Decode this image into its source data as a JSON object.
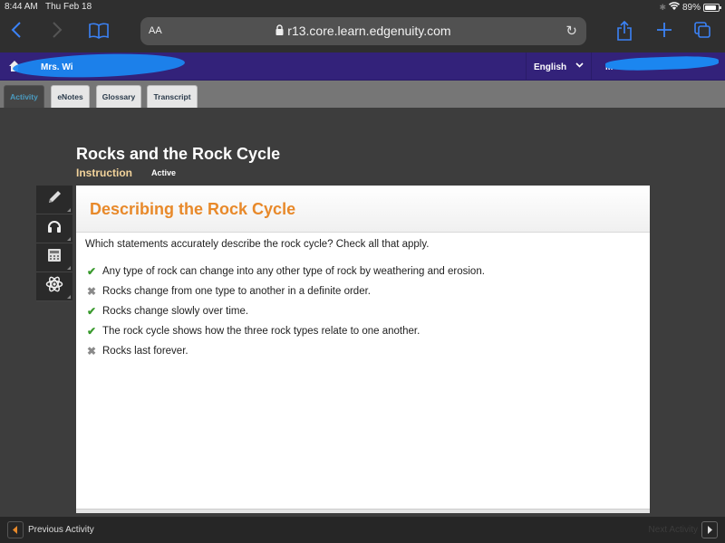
{
  "status_bar": {
    "time": "8:44 AM",
    "date": "Thu Feb 18",
    "battery_percent": "89%",
    "battery_level": 0.89
  },
  "browser": {
    "text_size_label": "AA",
    "url": "r13.core.learn.edgenuity.com",
    "icons": [
      "back-icon",
      "forward-icon",
      "bookmarks-icon",
      "lock-icon",
      "reload-icon",
      "share-icon",
      "new-tab-icon",
      "tabs-icon"
    ]
  },
  "app_header": {
    "course_title": "Mrs. Wi",
    "language": "English",
    "user_name": "M",
    "bg_color": "#33227a"
  },
  "tabs": [
    {
      "label": "Activity",
      "active": true
    },
    {
      "label": "eNotes",
      "active": false
    },
    {
      "label": "Glossary",
      "active": false
    },
    {
      "label": "Transcript",
      "active": false
    }
  ],
  "lesson": {
    "title": "Rocks and the Rock Cycle",
    "section": "Instruction",
    "status": "Active"
  },
  "tools": [
    {
      "name": "pencil-icon"
    },
    {
      "name": "headphones-icon"
    },
    {
      "name": "calculator-icon"
    },
    {
      "name": "atom-icon"
    }
  ],
  "card": {
    "title": "Describing the Rock Cycle",
    "title_color": "#e8892a",
    "question": "Which statements accurately describe the rock cycle? Check all that apply.",
    "answers": [
      {
        "text": "Any type of rock can change into any other type of rock by weathering and erosion.",
        "correct": true
      },
      {
        "text": "Rocks change from one type to another in a definite order.",
        "correct": false
      },
      {
        "text": "Rocks change slowly over time.",
        "correct": true
      },
      {
        "text": "The rock cycle shows how the three rock types relate to one another.",
        "correct": true
      },
      {
        "text": "Rocks last forever.",
        "correct": false
      }
    ]
  },
  "footer": {
    "previous_label": "Previous Activity",
    "next_label": "Next Activity"
  }
}
